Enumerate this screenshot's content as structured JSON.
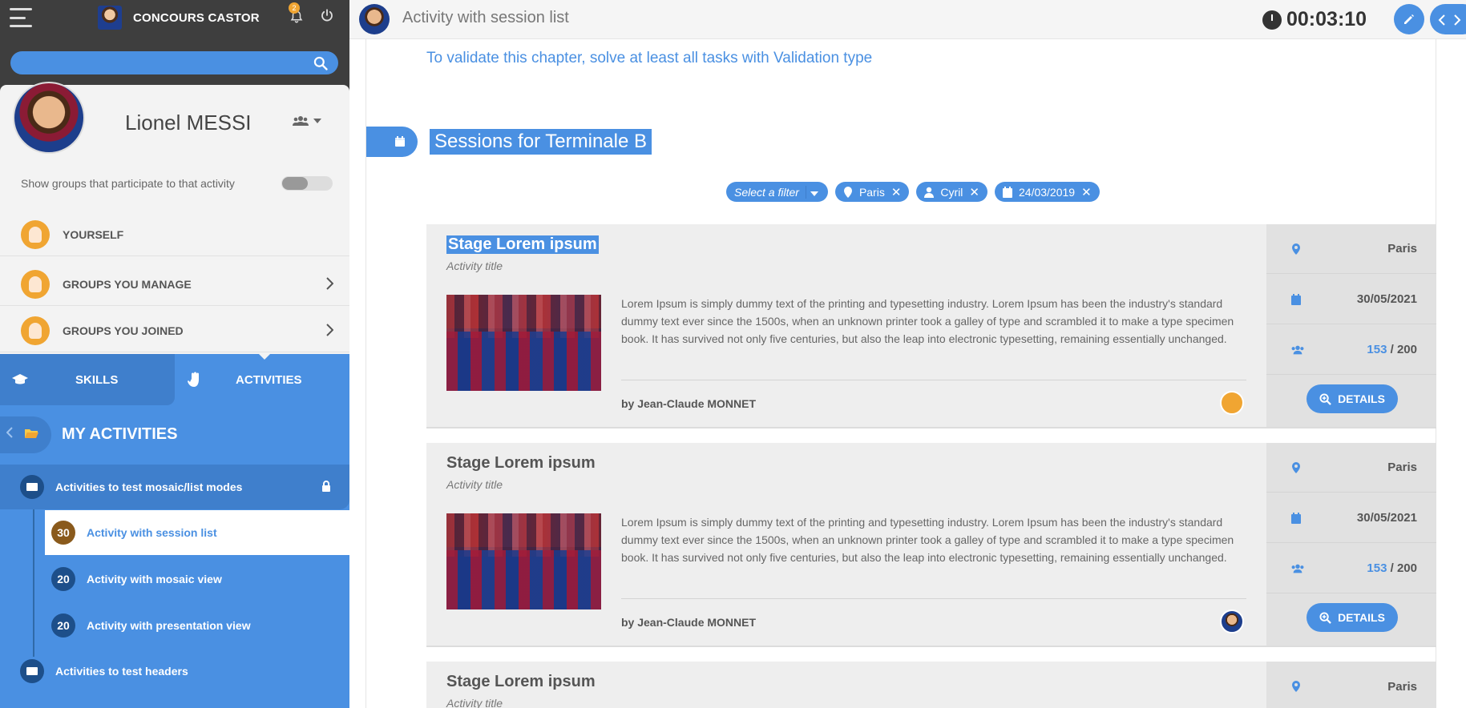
{
  "app": {
    "brand": "CONCOURS CASTOR",
    "notification_count": "2"
  },
  "search": {
    "placeholder": ""
  },
  "profile": {
    "name": "Lionel MESSI",
    "show_groups_label": "Show groups that participate to that activity"
  },
  "groups": [
    {
      "label": "YOURSELF"
    },
    {
      "label": "GROUPS YOU MANAGE"
    },
    {
      "label": "GROUPS YOU JOINED"
    }
  ],
  "tabs": {
    "skills": "SKILLS",
    "activities": "ACTIVITIES"
  },
  "my_activities": {
    "label": "MY ACTIVITIES"
  },
  "chapters": [
    {
      "label": "Activities to test mosaic/list modes"
    },
    {
      "label": "Activities to test headers"
    }
  ],
  "activities": [
    {
      "num": "30",
      "label": "Activity with session list",
      "color": "#8a5a1c"
    },
    {
      "num": "20",
      "label": "Activity with mosaic view",
      "color": "#1d4f8a"
    },
    {
      "num": "20",
      "label": "Activity with presentation view",
      "color": "#1d4f8a"
    }
  ],
  "topbar": {
    "title": "Activity with session list",
    "timer": "00:03:10"
  },
  "main": {
    "validate_text": "To validate this chapter, solve at least all tasks with Validation type",
    "sessions_title": "Sessions for Terminale B"
  },
  "filters": {
    "select_label": "Select a filter",
    "place": "Paris",
    "person": "Cyril",
    "date": "24/03/2019"
  },
  "sessions": [
    {
      "title": "Stage Lorem ipsum",
      "subtitle": "Activity title",
      "description": "Lorem Ipsum is simply dummy text of the printing and typesetting industry. Lorem Ipsum has been the industry's standard dummy text ever since the 1500s, when an unknown printer took a galley of type and scrambled it to make a type specimen book. It has survived not only five centuries, but also the leap into electronic typesetting, remaining essentially unchanged.",
      "author": "by Jean-Claude MONNET",
      "place": "Paris",
      "date": "30/05/2021",
      "enrolled": "153",
      "capacity": "/ 200",
      "details_label": "DETAILS"
    },
    {
      "title": "Stage Lorem ipsum",
      "subtitle": "Activity title",
      "description": "Lorem Ipsum is simply dummy text of the printing and typesetting industry. Lorem Ipsum has been the industry's standard dummy text ever since the 1500s, when an unknown printer took a galley of type and scrambled it to make a type specimen book. It has survived not only five centuries, but also the leap into electronic typesetting, remaining essentially unchanged.",
      "author": "by Jean-Claude MONNET",
      "place": "Paris",
      "date": "30/05/2021",
      "enrolled": "153",
      "capacity": "/ 200",
      "details_label": "DETAILS"
    },
    {
      "title": "Stage Lorem ipsum",
      "subtitle": "Activity title",
      "place": "Paris"
    }
  ]
}
